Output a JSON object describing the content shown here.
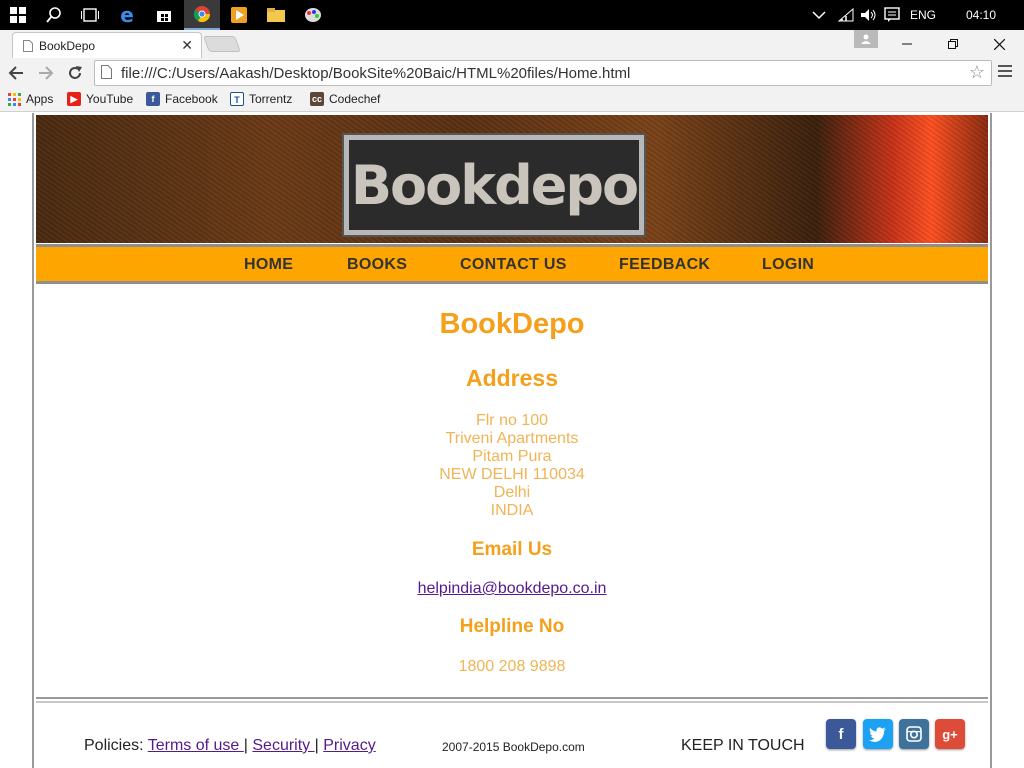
{
  "taskbar": {
    "icons": [
      "windows-icon",
      "search-icon",
      "task-view-icon",
      "edge-icon",
      "store-icon",
      "chrome-icon",
      "media-player-icon",
      "file-explorer-icon",
      "paint-icon"
    ],
    "language": "ENG",
    "time": "04:10"
  },
  "browser": {
    "tab_title": "BookDepo",
    "url": "file:///C:/Users/Aakash/Desktop/BookSite%20Baic/HTML%20files/Home.html",
    "bookmarks": [
      {
        "label": "Apps",
        "icon": "apps-grid-icon"
      },
      {
        "label": "YouTube",
        "icon": "youtube-icon"
      },
      {
        "label": "Facebook",
        "icon": "facebook-icon"
      },
      {
        "label": "Torrentz",
        "icon": "torrentz-icon"
      },
      {
        "label": "Codechef",
        "icon": "codechef-icon"
      }
    ]
  },
  "site": {
    "logo_text": "Bookdepo",
    "nav": [
      "HOME",
      "BOOKS",
      "CONTACT US",
      "FEEDBACK",
      "LOGIN"
    ],
    "title": "BookDepo",
    "address_heading": "Address",
    "address_lines": [
      "Flr no 100",
      "Triveni Apartments",
      "Pitam Pura",
      "NEW DELHI 110034",
      "Delhi",
      "INDIA"
    ],
    "email_heading": "Email Us",
    "email": "helpindia@bookdepo.co.in",
    "helpline_heading": "Helpline No",
    "helpline": "1800 208 9898",
    "footer": {
      "policies_label": "Policies:",
      "links": [
        "Terms of use ",
        "Security ",
        "Privacy "
      ],
      "copyright": "2007-2015 BookDepo.com",
      "keep_in_touch": "KEEP IN TOUCH",
      "social": [
        {
          "name": "facebook",
          "glyph": "f",
          "color": "#3b5998"
        },
        {
          "name": "twitter",
          "glyph": "t",
          "color": "#1da1f2"
        },
        {
          "name": "instagram",
          "glyph": "◙",
          "color": "#3f729b"
        },
        {
          "name": "google-plus",
          "glyph": "g+",
          "color": "#dd4b39"
        }
      ]
    }
  },
  "colors": {
    "accent": "#f4a01c",
    "nav_bar": "#ffa500",
    "link": "#551a8b"
  }
}
